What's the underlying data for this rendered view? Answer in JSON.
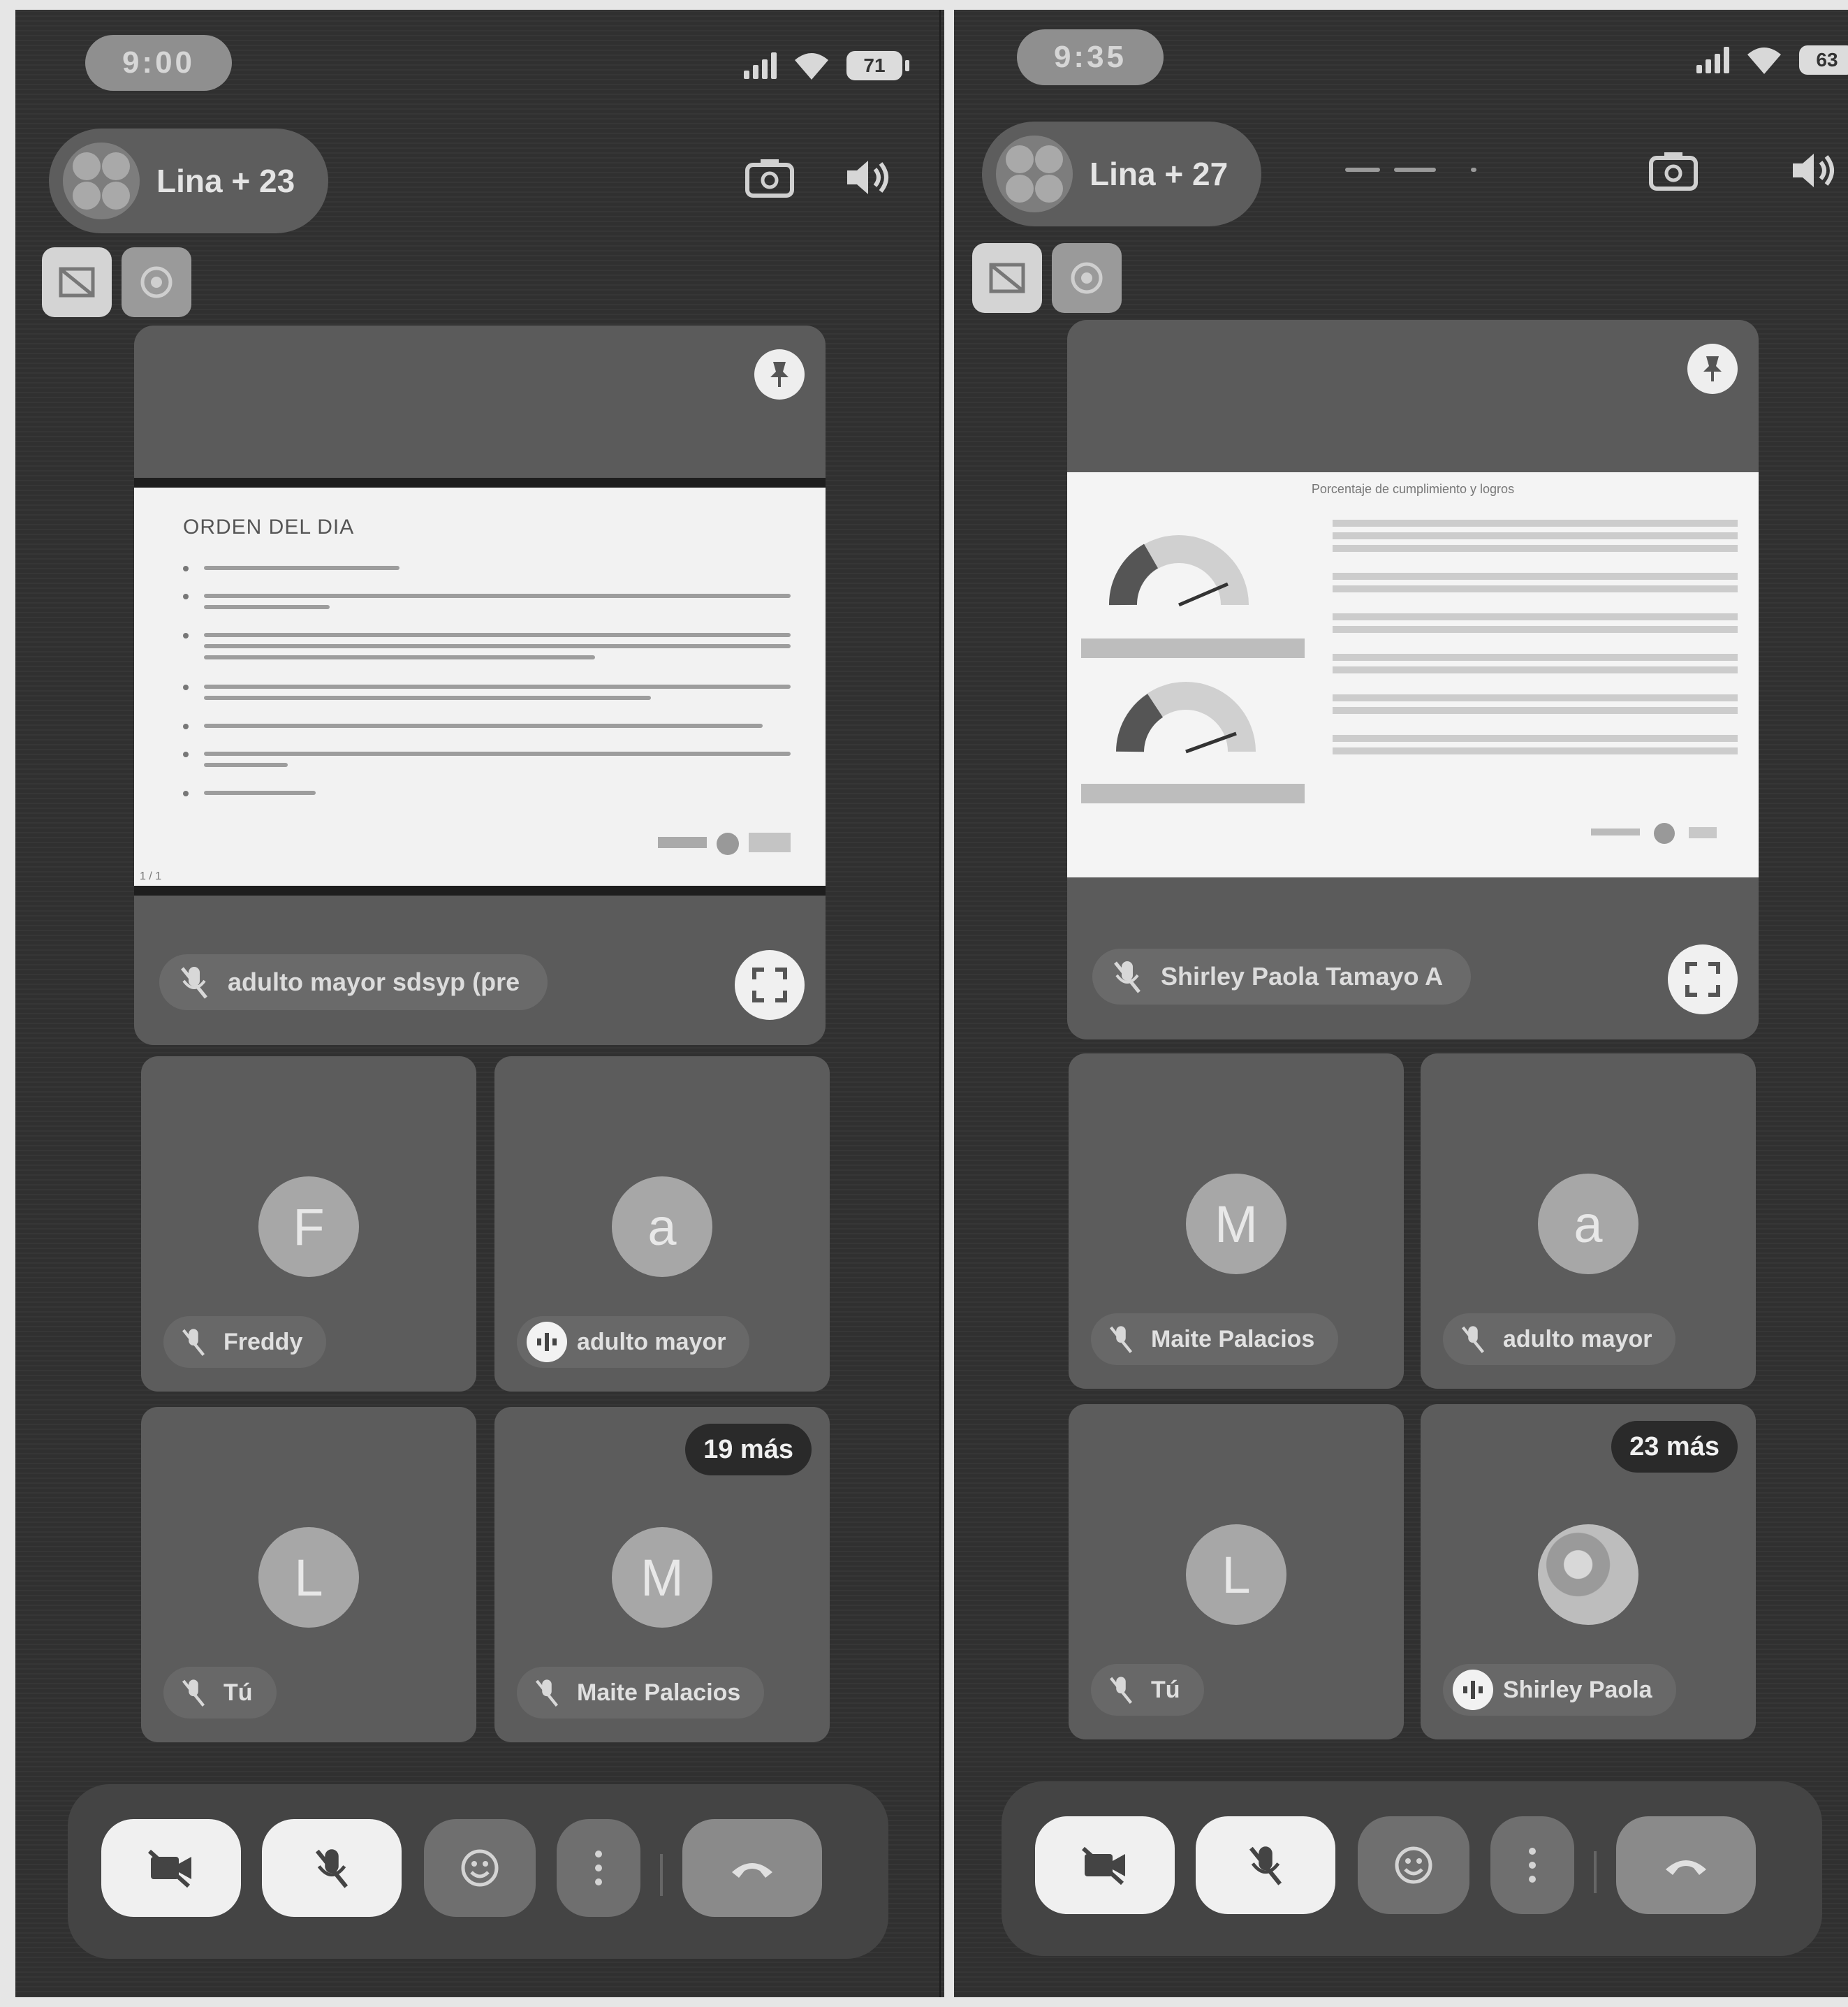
{
  "left": {
    "time": "9:00",
    "battery": "71",
    "call_title": "Lina + 23",
    "presenter": "adulto mayor sdsyp (pre",
    "slide": {
      "title": "ORDEN DEL DIA",
      "page_indicator": "1 / 1"
    },
    "participants": [
      {
        "initial": "F",
        "name": "Freddy",
        "mic": "muted"
      },
      {
        "initial": "a",
        "name": "adulto mayor",
        "mic": "speaking"
      },
      {
        "initial": "L",
        "name": "Tú",
        "mic": "muted"
      },
      {
        "initial": "M",
        "name": "Maite Palacios",
        "mic": "muted",
        "more": "19 más"
      }
    ]
  },
  "right": {
    "time": "9:35",
    "battery": "63",
    "call_title": "Lina + 27",
    "presenter": "Shirley Paola Tamayo A",
    "slide": {
      "title": "Porcentaje de cumplimiento y logros"
    },
    "participants": [
      {
        "initial": "M",
        "name": "Maite Palacios",
        "mic": "muted"
      },
      {
        "initial": "a",
        "name": "adulto mayor",
        "mic": "muted"
      },
      {
        "initial": "L",
        "name": "Tú",
        "mic": "muted"
      },
      {
        "initial": "",
        "name": "Shirley Paola",
        "mic": "speaking",
        "more": "23 más"
      }
    ]
  },
  "icons": {
    "camera_off": "camera-off-icon",
    "mic_off": "mic-off-icon",
    "emoji": "emoji-icon",
    "more": "more-vert-icon",
    "end_call": "end-call-icon"
  },
  "colors": {
    "background": "#303030",
    "tile": "#5c5c5c",
    "button_light": "#f0f0f0"
  }
}
